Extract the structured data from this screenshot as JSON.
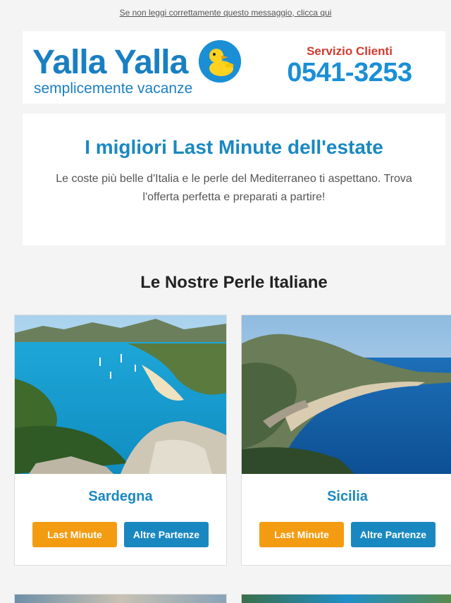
{
  "preheader": {
    "link_text": "Se non leggi correttamente questo messaggio, clicca qui"
  },
  "brand": {
    "name": "Yalla Yalla",
    "tagline": "semplicemente vacanze",
    "service_label": "Servizio Clienti",
    "phone": "0541-3253",
    "colors": {
      "brand_blue": "#1a7fc2",
      "service_red": "#d13a2e",
      "accent_orange": "#f39c12"
    }
  },
  "intro": {
    "title": "I migliori Last Minute dell'estate",
    "text": "Le coste più belle d'Italia e le perle del Mediterraneo ti aspettano. Trova l'offerta perfetta e preparati a partire!"
  },
  "section": {
    "title": "Le Nostre Perle Italiane"
  },
  "destinations": [
    {
      "name": "Sardegna",
      "primary_button": "Last Minute",
      "secondary_button": "Altre Partenze"
    },
    {
      "name": "Sicilia",
      "primary_button": "Last Minute",
      "secondary_button": "Altre Partenze"
    }
  ],
  "icons": {
    "duck": "duck-mascot-icon"
  }
}
